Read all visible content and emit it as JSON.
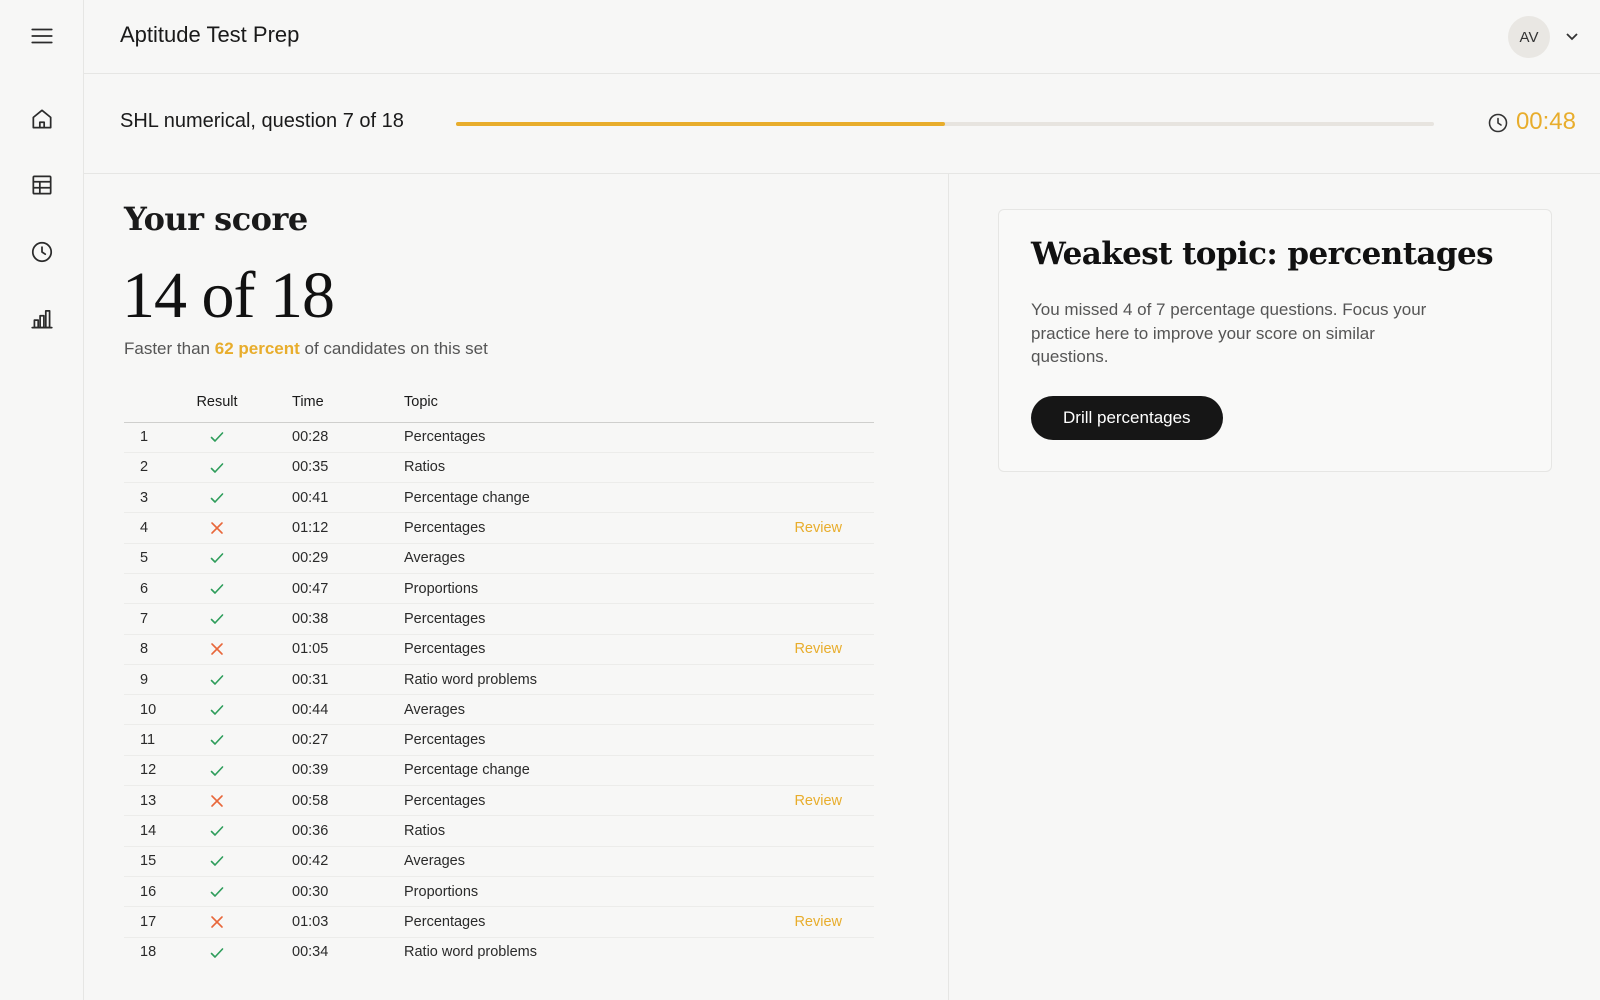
{
  "app": {
    "title": "Aptitude Test Prep"
  },
  "user": {
    "initials": "AV"
  },
  "sidebar": {
    "items": [
      {
        "name": "home",
        "icon": "home-icon"
      },
      {
        "name": "tests",
        "icon": "table-icon"
      },
      {
        "name": "history",
        "icon": "clock-icon"
      },
      {
        "name": "stats",
        "icon": "bar-chart-icon"
      }
    ]
  },
  "question_bar": {
    "label": "SHL numerical, question 7 of 18",
    "progress": 0.5,
    "timer": "00:48"
  },
  "score": {
    "heading": "Your score",
    "value": "14 of 18",
    "sub_prefix": "Faster than",
    "sub_highlight": "62 percent",
    "sub_suffix": "of candidates on this set"
  },
  "table": {
    "headers": {
      "num": "",
      "result": "Result",
      "time": "Time",
      "topic": "Topic",
      "action": ""
    },
    "rows": [
      {
        "num": "1",
        "result": "correct",
        "time": "00:28",
        "topic": "Percentages",
        "action": ""
      },
      {
        "num": "2",
        "result": "correct",
        "time": "00:35",
        "topic": "Ratios",
        "action": ""
      },
      {
        "num": "3",
        "result": "correct",
        "time": "00:41",
        "topic": "Percentage change",
        "action": ""
      },
      {
        "num": "4",
        "result": "incorrect",
        "time": "01:12",
        "topic": "Percentages",
        "action": "Review"
      },
      {
        "num": "5",
        "result": "correct",
        "time": "00:29",
        "topic": "Averages",
        "action": ""
      },
      {
        "num": "6",
        "result": "correct",
        "time": "00:47",
        "topic": "Proportions",
        "action": ""
      },
      {
        "num": "7",
        "result": "correct",
        "time": "00:38",
        "topic": "Percentages",
        "action": ""
      },
      {
        "num": "8",
        "result": "incorrect",
        "time": "01:05",
        "topic": "Percentages",
        "action": "Review"
      },
      {
        "num": "9",
        "result": "correct",
        "time": "00:31",
        "topic": "Ratio word problems",
        "action": ""
      },
      {
        "num": "10",
        "result": "correct",
        "time": "00:44",
        "topic": "Averages",
        "action": ""
      },
      {
        "num": "11",
        "result": "correct",
        "time": "00:27",
        "topic": "Percentages",
        "action": ""
      },
      {
        "num": "12",
        "result": "correct",
        "time": "00:39",
        "topic": "Percentage change",
        "action": ""
      },
      {
        "num": "13",
        "result": "incorrect",
        "time": "00:58",
        "topic": "Percentages",
        "action": "Review"
      },
      {
        "num": "14",
        "result": "correct",
        "time": "00:36",
        "topic": "Ratios",
        "action": ""
      },
      {
        "num": "15",
        "result": "correct",
        "time": "00:42",
        "topic": "Averages",
        "action": ""
      },
      {
        "num": "16",
        "result": "correct",
        "time": "00:30",
        "topic": "Proportions",
        "action": ""
      },
      {
        "num": "17",
        "result": "incorrect",
        "time": "01:03",
        "topic": "Percentages",
        "action": "Review"
      },
      {
        "num": "18",
        "result": "correct",
        "time": "00:34",
        "topic": "Ratio word problems",
        "action": ""
      }
    ]
  },
  "weak_topic": {
    "title": "Weakest topic: percentages",
    "body": "You missed 4 of 7 percentage questions. Focus your practice here to improve your score on similar questions.",
    "button": "Drill percentages"
  },
  "colors": {
    "accent": "#e8ad2c",
    "correct": "#2e9d5b",
    "incorrect": "#e8673a",
    "button": "#161616",
    "background": "#f7f7f6"
  }
}
